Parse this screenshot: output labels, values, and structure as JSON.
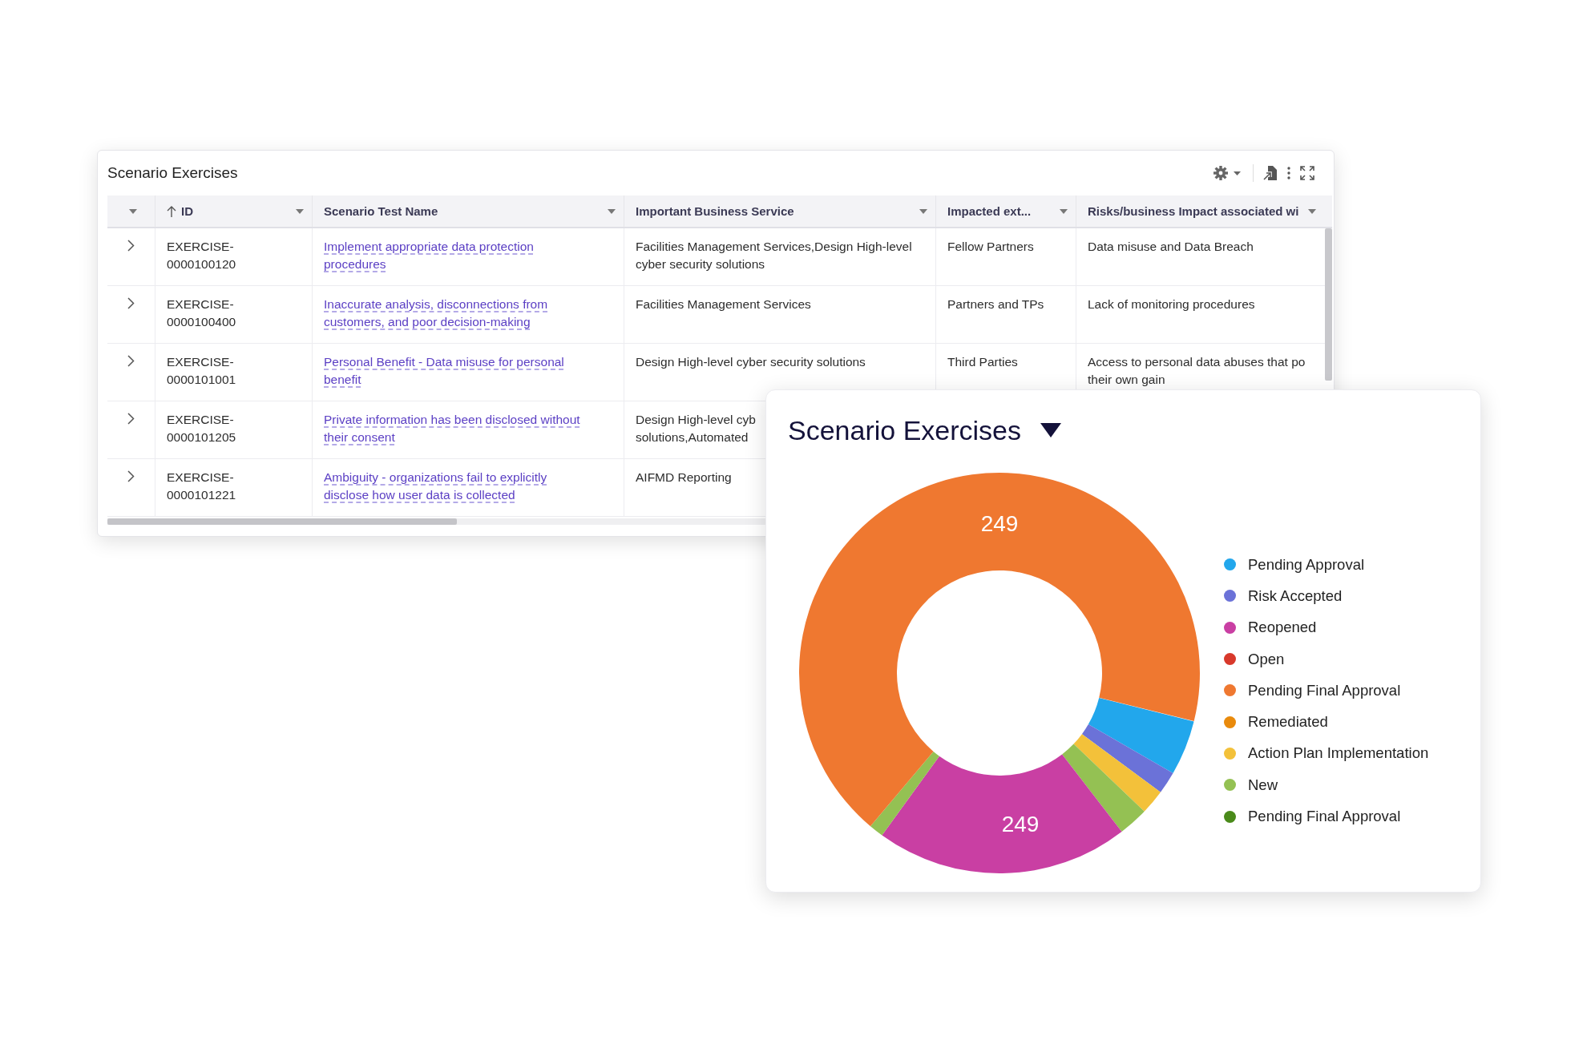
{
  "table_panel": {
    "title": "Scenario Exercises",
    "columns": [
      {
        "label": "ID",
        "sorted": true
      },
      {
        "label": "Scenario Test Name",
        "sorted": false
      },
      {
        "label": "Important Business Service",
        "sorted": false
      },
      {
        "label": "Impacted ext...",
        "sorted": false
      },
      {
        "label": "Risks/business Impact associated wi",
        "sorted": false
      }
    ],
    "rows": [
      {
        "id": "EXERCISE-0000100120",
        "name": "Implement appropriate data protection procedures",
        "service": [
          "Facilities Management Services,Design High-level",
          "cyber security solutions"
        ],
        "impacted": "Fellow Partners",
        "risk": [
          "Data misuse and Data Breach"
        ]
      },
      {
        "id": "EXERCISE-0000100400",
        "name": "Inaccurate analysis, disconnections from customers, and poor decision-making",
        "service": [
          "Facilities Management Services"
        ],
        "impacted": "Partners and TPs",
        "risk": [
          "Lack of monitoring procedures"
        ]
      },
      {
        "id": "EXERCISE-0000101001",
        "name": "Personal Benefit - Data misuse for personal benefit",
        "service": [
          "Design High-level cyber security solutions"
        ],
        "impacted": "Third Parties",
        "risk": [
          "Access to personal data abuses that po",
          "their own gain"
        ]
      },
      {
        "id": "EXERCISE-0000101205",
        "name": "Private information has been disclosed without their consent",
        "service": [
          "Design High-level cyb",
          "solutions,Automated"
        ]
      },
      {
        "id": "EXERCISE-0000101221",
        "name": "Ambiguity - organizations fail to explicitly disclose how user data is collected",
        "service": [
          "AIFMD Reporting"
        ]
      }
    ]
  },
  "chart_panel": {
    "title": "Scenario Exercises",
    "slice_labels": [
      "249",
      "249"
    ],
    "legend": [
      {
        "label": "Pending Approval",
        "color": "#22a7ec"
      },
      {
        "label": "Risk Accepted",
        "color": "#6b72d8"
      },
      {
        "label": "Reopened",
        "color": "#c93fa3"
      },
      {
        "label": "Open",
        "color": "#d8392b"
      },
      {
        "label": "Pending Final Approval",
        "color": "#ef7830"
      },
      {
        "label": "Remediated",
        "color": "#e98a0c"
      },
      {
        "label": "Action Plan Implementation",
        "color": "#f3c13a"
      },
      {
        "label": "New",
        "color": "#94c153"
      },
      {
        "label": "Pending Final Approval",
        "color": "#4a8a1a"
      }
    ]
  }
}
